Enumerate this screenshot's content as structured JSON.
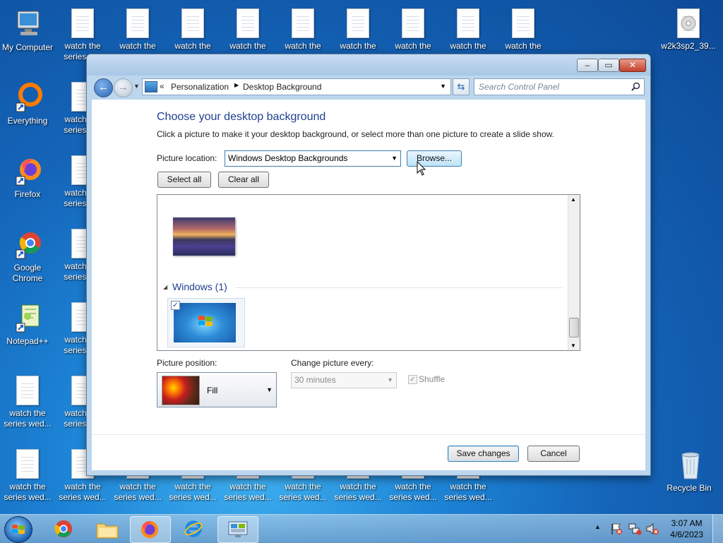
{
  "desktop": {
    "top_row": [
      {
        "label": "My Computer"
      },
      {
        "label": "watch the series w..."
      },
      {
        "label": "watch the"
      },
      {
        "label": "watch the"
      },
      {
        "label": "watch the"
      },
      {
        "label": "watch the"
      },
      {
        "label": "watch the"
      },
      {
        "label": "watch the"
      },
      {
        "label": "watch the"
      },
      {
        "label": "watch the"
      }
    ],
    "top_right": {
      "label": "w2k3sp2_39..."
    },
    "left_col": [
      {
        "label": "Everything"
      },
      {
        "label": "Firefox"
      },
      {
        "label": "Google Chrome"
      },
      {
        "label": "Notepad++"
      },
      {
        "label": "watch the series wed..."
      },
      {
        "label": "watch the series wed..."
      }
    ],
    "second_col": [
      {
        "label": "watch the series w..."
      },
      {
        "label": "watch the series w..."
      },
      {
        "label": "watch the series w..."
      },
      {
        "label": "watch the series w..."
      },
      {
        "label": "watch the series w..."
      },
      {
        "label": "watch the series wed..."
      }
    ],
    "bottom_row": [
      {
        "label": "watch the series wed..."
      },
      {
        "label": "watch the series wed..."
      },
      {
        "label": "watch the series wed..."
      },
      {
        "label": "watch the series wed..."
      },
      {
        "label": "watch the series wed..."
      },
      {
        "label": "watch the series wed..."
      },
      {
        "label": "watch the series wed..."
      }
    ],
    "recycle": {
      "label": "Recycle Bin"
    }
  },
  "window": {
    "breadcrumb": {
      "prefix": "«",
      "part1": "Personalization",
      "part2": "Desktop Background"
    },
    "search_placeholder": "Search Control Panel",
    "title": "Choose your desktop background",
    "subtitle": "Click a picture to make it your desktop background, or select more than one picture to create a slide show.",
    "picture_location_label": "Picture location:",
    "picture_location_value": "Windows Desktop Backgrounds",
    "browse_label": "Browse...",
    "select_all_label": "Select all",
    "clear_all_label": "Clear all",
    "group_label": "Windows (1)",
    "picture_position_label": "Picture position:",
    "picture_position_value": "Fill",
    "change_picture_label": "Change picture every:",
    "change_picture_value": "30 minutes",
    "shuffle_label": "Shuffle",
    "save_label": "Save changes",
    "cancel_label": "Cancel"
  },
  "taskbar": {
    "time": "3:07 AM",
    "date": "4/6/2023"
  },
  "colors": {
    "accent": "#1e3f8e",
    "desktop": "#1464b8"
  }
}
